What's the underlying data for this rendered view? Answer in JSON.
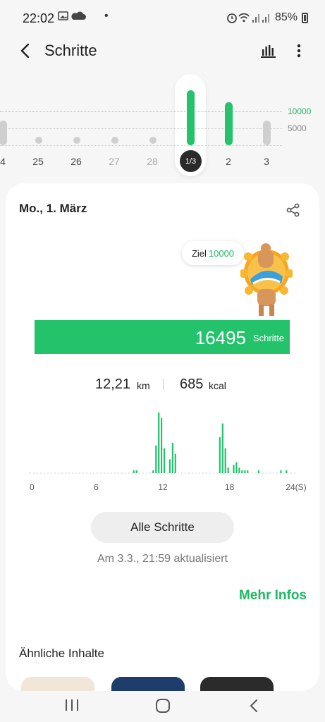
{
  "status_bar": {
    "time": "22:02",
    "battery": "85%"
  },
  "header": {
    "title": "Schritte"
  },
  "day_selector": {
    "goal_label": "10000",
    "half_label": "5000",
    "days": [
      {
        "label": "4",
        "has_bar": true,
        "bar_fraction": 0.45,
        "color": "#cfcfcf"
      },
      {
        "label": "25",
        "has_bar": false
      },
      {
        "label": "26",
        "has_bar": false
      },
      {
        "label": "27",
        "has_bar": false
      },
      {
        "label": "28",
        "has_bar": false
      },
      {
        "label": "1/3",
        "has_bar": true,
        "bar_fraction": 1.0,
        "color": "#23c26b",
        "selected": true
      },
      {
        "label": "2",
        "has_bar": true,
        "bar_fraction": 0.78,
        "color": "#23c26b"
      },
      {
        "label": "3",
        "has_bar": true,
        "bar_fraction": 0.45,
        "color": "#cfcfcf"
      }
    ]
  },
  "card": {
    "date": "Mo., 1. März",
    "goal_prefix": "Ziel",
    "goal_value": "10000",
    "steps_value": "16495",
    "steps_unit": "Schritte",
    "distance_value": "12,21",
    "distance_unit": "km",
    "calories_value": "685",
    "calories_unit": "kcal",
    "all_steps_button": "Alle Schritte",
    "updated_text": "Am 3.3., 21:59 aktualisiert",
    "more_info": "Mehr Infos",
    "similar_title": "Ähnliche Inhalte"
  },
  "chart_data": {
    "type": "bar",
    "x_tick_labels": [
      "0",
      "6",
      "12",
      "18",
      "24(S)"
    ],
    "x_ticks": [
      0,
      6,
      12,
      18,
      24
    ],
    "xlim": [
      0,
      24
    ],
    "values_per_slot": 4,
    "values": [
      0,
      0,
      0,
      0,
      0,
      0,
      0,
      0,
      0,
      0,
      0,
      0,
      0,
      0,
      0,
      0,
      0,
      0,
      0,
      0,
      0,
      0,
      0,
      0,
      0,
      0,
      0,
      0,
      0,
      0,
      0,
      0,
      0,
      0,
      0,
      0,
      0,
      1,
      1,
      0,
      0,
      0,
      0,
      0,
      1,
      10,
      22,
      20,
      9,
      0,
      5,
      11,
      7,
      0,
      0,
      0,
      0,
      0,
      0,
      0,
      0,
      0,
      0,
      0,
      0,
      0,
      0,
      0,
      13,
      18,
      9,
      2,
      0,
      3,
      4,
      2,
      1,
      1,
      1,
      0,
      0,
      0,
      1,
      0,
      0,
      0,
      0,
      0,
      0,
      0,
      1,
      0,
      1,
      0,
      0,
      0
    ],
    "ylim": [
      0,
      22
    ],
    "color": "#23c26b"
  },
  "colors": {
    "accent": "#23c26b",
    "accent_text": "#1fb865",
    "background": "#f6f6f6",
    "card": "#ffffff"
  },
  "icons": {
    "back": "chevron-left-icon",
    "chart": "bar-chart-icon",
    "more": "more-vertical-icon",
    "share": "share-icon"
  }
}
